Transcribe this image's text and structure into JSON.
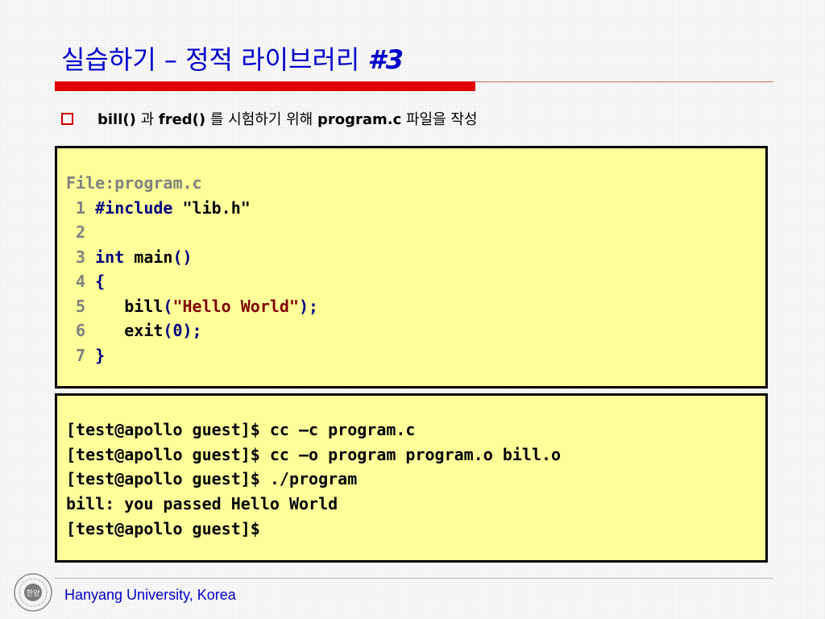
{
  "slide": {
    "title_text": "실습하기 – 정적 라이브러리 ",
    "title_num": "#3",
    "bullet": {
      "part1": "bill()",
      "part2": " 과 ",
      "part3": "fred()",
      "part4": " 를 시험하기 위해 ",
      "part5": "program.c",
      "part6": " 파일을 작성"
    },
    "code": {
      "file_label": "File:program.c",
      "lines": [
        {
          "num": " 1 ",
          "a": "#include ",
          "b": "\"lib.h\""
        },
        {
          "num": " 2",
          "a": "",
          "b": ""
        },
        {
          "num": " 3 ",
          "a": "int ",
          "b": "main",
          "c": "()"
        },
        {
          "num": " 4 ",
          "a": "{"
        },
        {
          "num": " 5 ",
          "a": "   bill",
          "b": "(",
          "c": "\"Hello World\"",
          "d": ");"
        },
        {
          "num": " 6 ",
          "a": "   exit",
          "b": "(0);"
        },
        {
          "num": " 7 ",
          "a": "}"
        }
      ]
    },
    "terminal": {
      "lines": [
        "[test@apollo guest]$ cc –c program.c",
        "[test@apollo guest]$ cc –o program program.o bill.o",
        "[test@apollo guest]$ ./program",
        "bill: you passed Hello World",
        "[test@apollo guest]$"
      ]
    },
    "footer": "Hanyang University, Korea",
    "logo_text": "한양",
    "colors": {
      "title": "#0000cc",
      "accent_red": "#e00000",
      "code_bg": "#ffff99",
      "code_gray": "#808080",
      "code_blue": "#000080",
      "code_string": "#800000"
    }
  }
}
